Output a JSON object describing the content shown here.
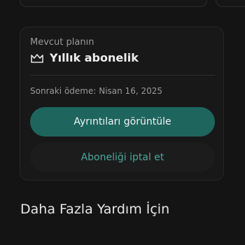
{
  "plan_card": {
    "label": "Mevcut planın",
    "plan_name": "Yıllık abonelik",
    "plan_icon": "crown-icon",
    "next_payment": "Sonraki ödeme: Nisan 16, 2025",
    "details_button": "Ayrıntıları görüntüle",
    "cancel_button": "Aboneliği iptal et"
  },
  "help_section": {
    "title": "Daha Fazla Yardım İçin"
  },
  "colors": {
    "accent": "#1e655e",
    "accent_text": "#4aa79c",
    "background": "#141414"
  }
}
